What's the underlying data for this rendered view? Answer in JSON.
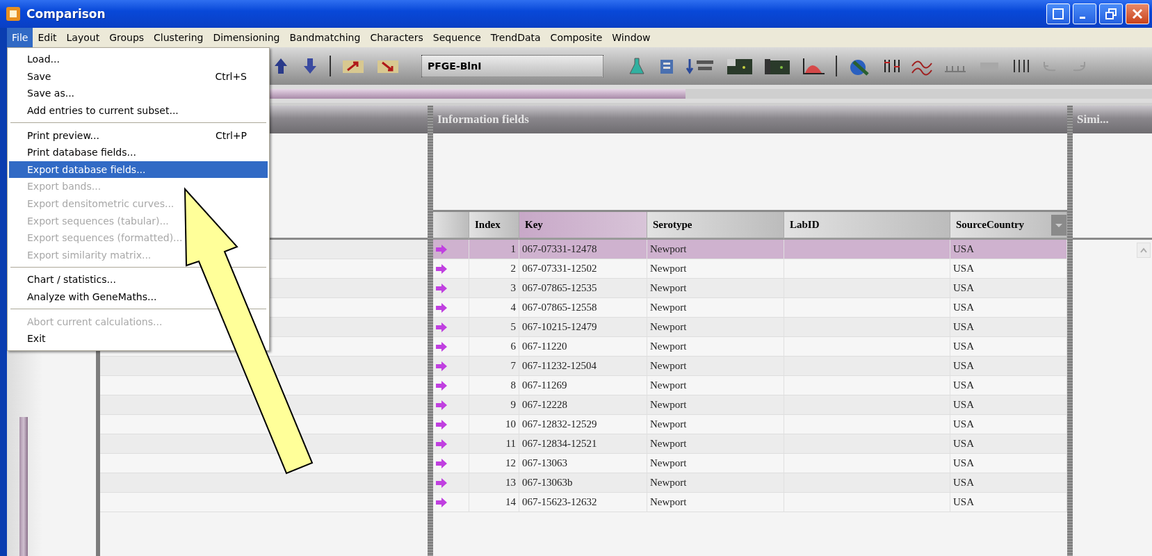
{
  "window": {
    "title": "Comparison"
  },
  "menu_bar": [
    {
      "label": "File",
      "selected": true
    },
    {
      "label": "Edit",
      "selected": false
    },
    {
      "label": "Layout",
      "selected": false
    },
    {
      "label": "Groups",
      "selected": false
    },
    {
      "label": "Clustering",
      "selected": false
    },
    {
      "label": "Dimensioning",
      "selected": false
    },
    {
      "label": "Bandmatching",
      "selected": false
    },
    {
      "label": "Characters",
      "selected": false
    },
    {
      "label": "Sequence",
      "selected": false
    },
    {
      "label": "TrendData",
      "selected": false
    },
    {
      "label": "Composite",
      "selected": false
    },
    {
      "label": "Window",
      "selected": false
    }
  ],
  "file_menu": [
    {
      "kind": "item",
      "label": "Load...",
      "disabled": false,
      "selected": false
    },
    {
      "kind": "item",
      "label": "Save",
      "shortcut": "Ctrl+S",
      "disabled": false,
      "selected": false
    },
    {
      "kind": "item",
      "label": "Save as...",
      "disabled": false,
      "selected": false
    },
    {
      "kind": "item",
      "label": "Add entries to current subset...",
      "disabled": false,
      "selected": false
    },
    {
      "kind": "separator"
    },
    {
      "kind": "item",
      "label": "Print preview...",
      "shortcut": "Ctrl+P",
      "disabled": false,
      "selected": false
    },
    {
      "kind": "item",
      "label": "Print database fields...",
      "disabled": false,
      "selected": false
    },
    {
      "kind": "item",
      "label": "Export database fields...",
      "disabled": false,
      "selected": true
    },
    {
      "kind": "item",
      "label": "Export bands...",
      "disabled": true,
      "selected": false
    },
    {
      "kind": "item",
      "label": "Export densitometric curves...",
      "disabled": true,
      "selected": false
    },
    {
      "kind": "item",
      "label": "Export sequences (tabular)...",
      "disabled": true,
      "selected": false
    },
    {
      "kind": "item",
      "label": "Export sequences (formatted)...",
      "disabled": true,
      "selected": false
    },
    {
      "kind": "item",
      "label": "Export similarity matrix...",
      "disabled": true,
      "selected": false
    },
    {
      "kind": "separator"
    },
    {
      "kind": "item",
      "label": "Chart / statistics...",
      "disabled": false,
      "selected": false
    },
    {
      "kind": "item",
      "label": "Analyze with GeneMaths...",
      "disabled": false,
      "selected": false
    },
    {
      "kind": "separator"
    },
    {
      "kind": "item",
      "label": "Abort current calculations...",
      "disabled": true,
      "selected": false
    },
    {
      "kind": "item",
      "label": "Exit",
      "disabled": false,
      "selected": false
    }
  ],
  "toolbar": {
    "experiment": "PFGE-BlnI"
  },
  "progress": {
    "level": 0.59
  },
  "information_panel": {
    "title": "Information fields"
  },
  "similarity_panel": {
    "title": "Simi..."
  },
  "table": {
    "columns": [
      {
        "label": "Index",
        "selected": false
      },
      {
        "label": "Key",
        "selected": true
      },
      {
        "label": "Serotype",
        "selected": false
      },
      {
        "label": "LabID",
        "selected": false
      },
      {
        "label": "SourceCountry",
        "selected": false
      }
    ],
    "rows": [
      {
        "index": "1",
        "key": "067-07331-12478",
        "serotype": "Newport",
        "country": "USA",
        "selected": true
      },
      {
        "index": "2",
        "key": "067-07331-12502",
        "serotype": "Newport",
        "country": "USA",
        "selected": false
      },
      {
        "index": "3",
        "key": "067-07865-12535",
        "serotype": "Newport",
        "country": "USA",
        "selected": false
      },
      {
        "index": "4",
        "key": "067-07865-12558",
        "serotype": "Newport",
        "country": "USA",
        "selected": false
      },
      {
        "index": "5",
        "key": "067-10215-12479",
        "serotype": "Newport",
        "country": "USA",
        "selected": false
      },
      {
        "index": "6",
        "key": "067-11220",
        "serotype": "Newport",
        "country": "USA",
        "selected": false
      },
      {
        "index": "7",
        "key": "067-11232-12504",
        "serotype": "Newport",
        "country": "USA",
        "selected": false
      },
      {
        "index": "8",
        "key": "067-11269",
        "serotype": "Newport",
        "country": "USA",
        "selected": false
      },
      {
        "index": "9",
        "key": "067-12228",
        "serotype": "Newport",
        "country": "USA",
        "selected": false
      },
      {
        "index": "10",
        "key": "067-12832-12529",
        "serotype": "Newport",
        "country": "USA",
        "selected": false
      },
      {
        "index": "11",
        "key": "067-12834-12521",
        "serotype": "Newport",
        "country": "USA",
        "selected": false
      },
      {
        "index": "12",
        "key": "067-13063",
        "serotype": "Newport",
        "country": "USA",
        "selected": false
      },
      {
        "index": "13",
        "key": "067-13063b",
        "serotype": "Newport",
        "country": "USA",
        "selected": false
      },
      {
        "index": "14",
        "key": "067-15623-12632",
        "serotype": "Newport",
        "country": "USA",
        "selected": false
      }
    ]
  }
}
